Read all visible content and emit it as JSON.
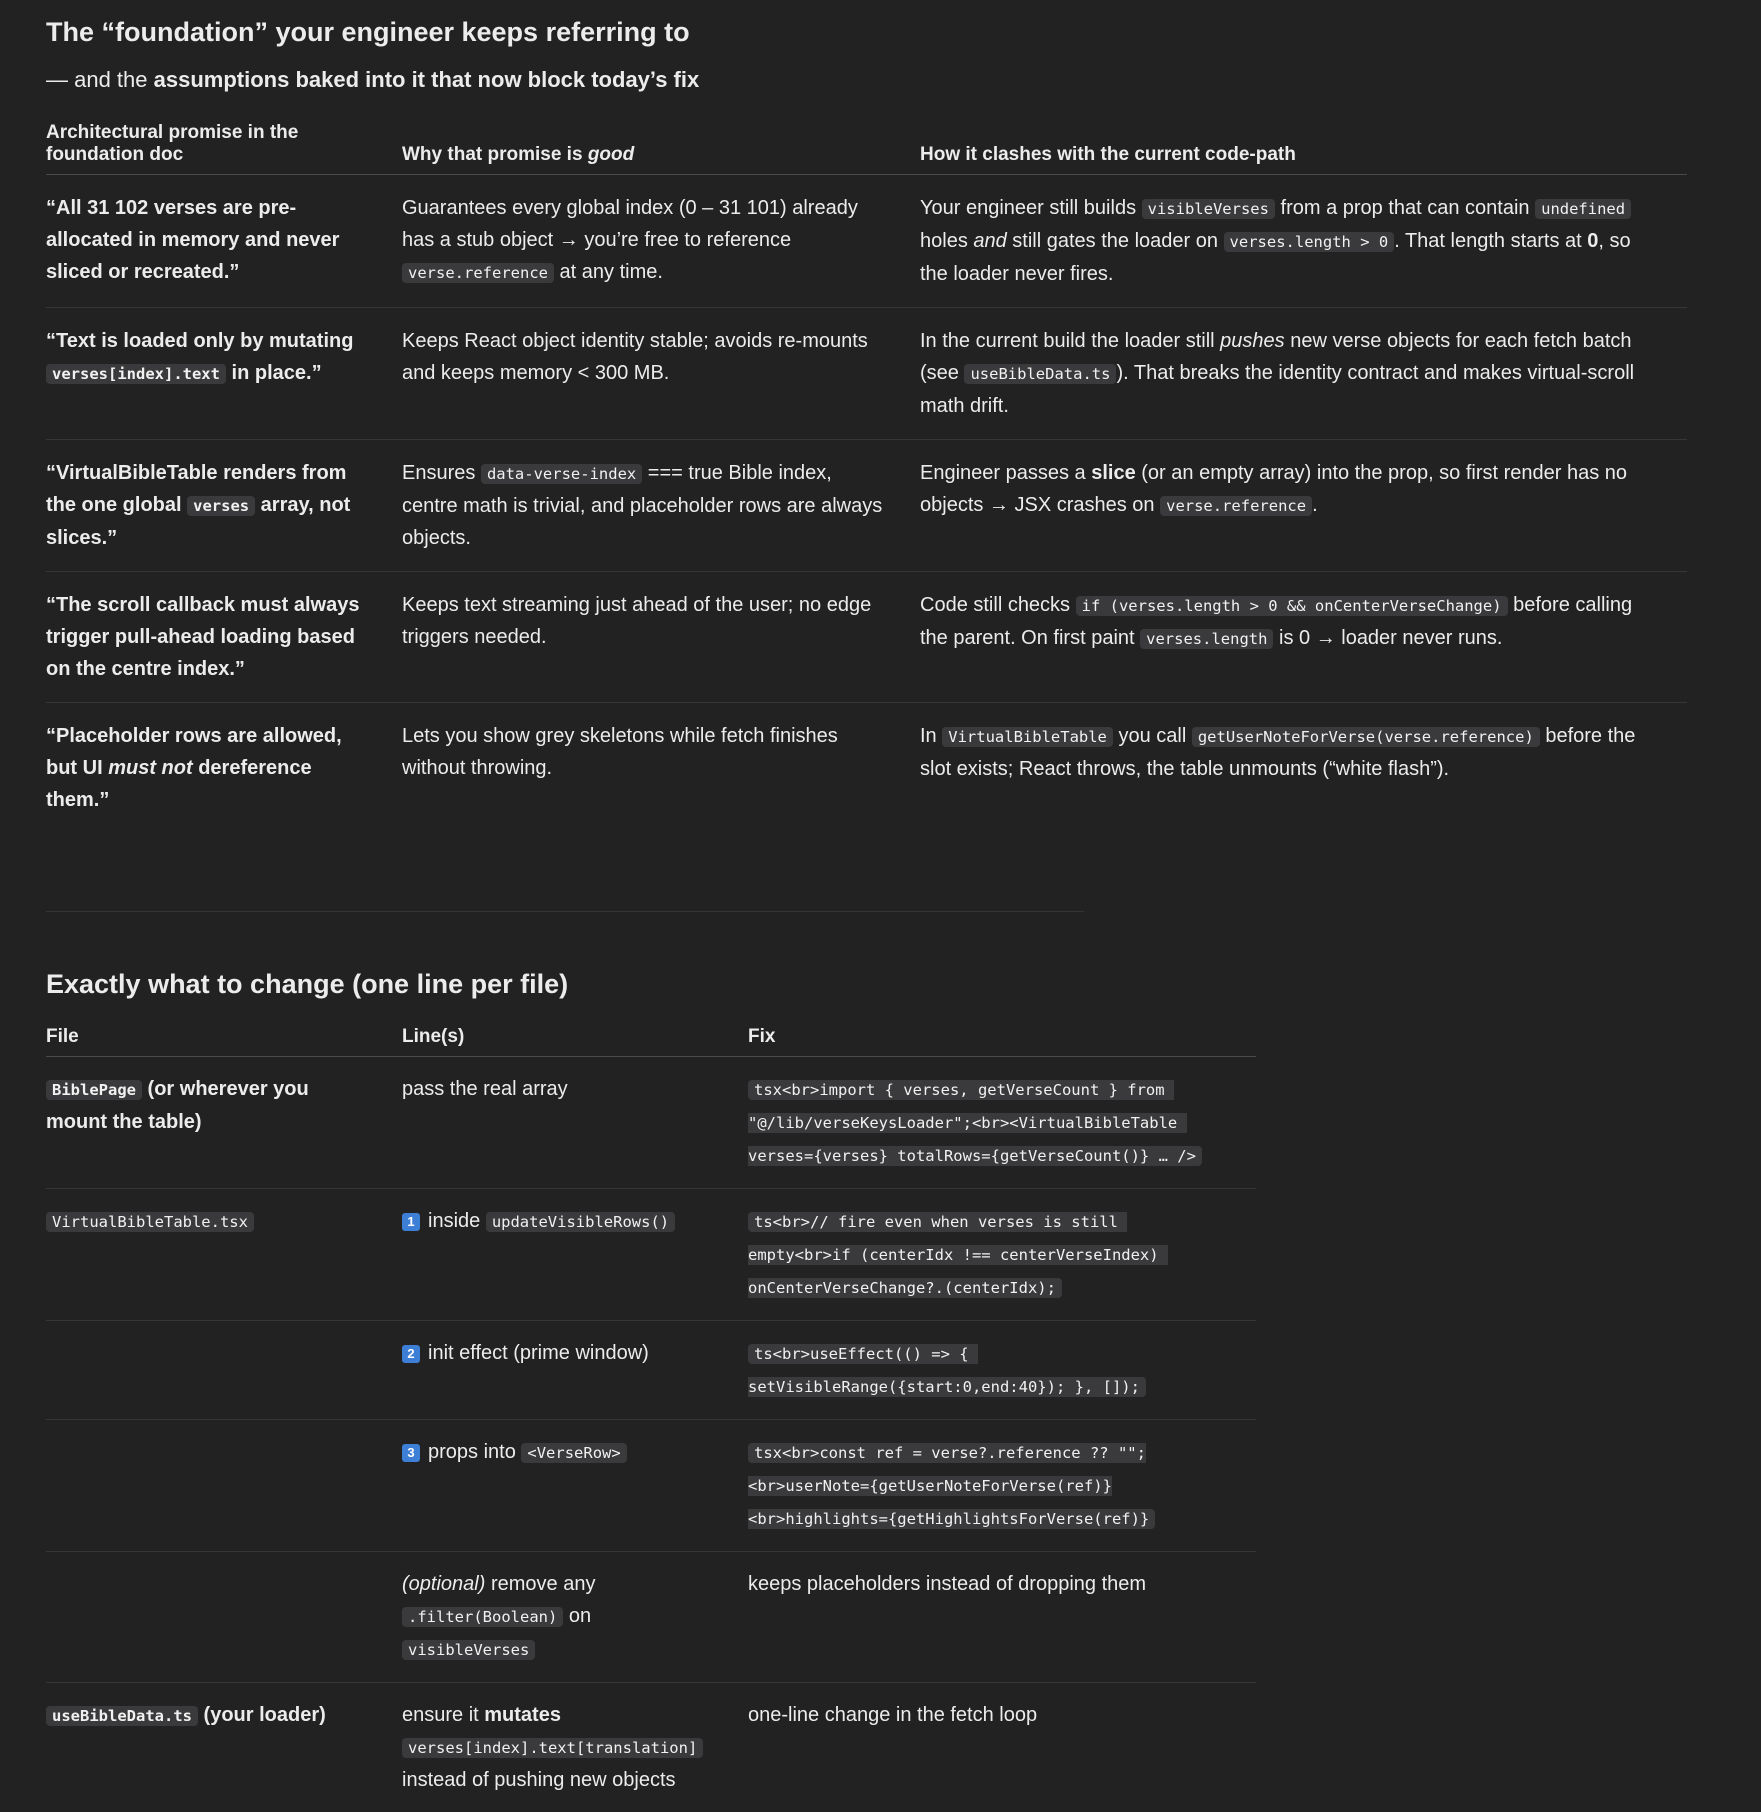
{
  "heading": "The “foundation” your engineer keeps referring to",
  "subtitle": {
    "prefix": "— and the ",
    "bold": "assumptions baked into it that now block today’s fix"
  },
  "promises_table": {
    "headers": {
      "col1": "Architectural promise in the foundation doc",
      "col2_prefix": "Why that promise is ",
      "col2_em": "good",
      "col3": "How it clashes with the current code-path"
    },
    "rows": [
      {
        "promise": "“All 31 102 verses are pre-allocated in memory and never sliced or recreated.”",
        "why": [
          "Guarantees every global index (0 – 31 101) already has a stub object → you’re free to reference ",
          "verse.reference",
          " at any time."
        ],
        "clash": [
          "Your engineer still builds ",
          "visibleVerses",
          " from a prop that can contain ",
          "undefined",
          " holes ",
          "and",
          " still gates the loader on ",
          "verses.length > 0",
          ". That length starts at ",
          "0",
          ", so the loader never fires."
        ]
      },
      {
        "promise": [
          "“Text is loaded only by mutating ",
          "verses[index].text",
          " in place.”"
        ],
        "why": "Keeps React object identity stable; avoids re-mounts and keeps memory < 300 MB.",
        "clash": [
          "In the current build the loader still ",
          "pushes",
          " new verse objects for each fetch batch (see ",
          "useBibleData.ts",
          "). That breaks the identity contract and makes virtual-scroll math drift."
        ]
      },
      {
        "promise": [
          "“VirtualBibleTable renders from the one global ",
          "verses",
          " array, not slices.”"
        ],
        "why": [
          "Ensures ",
          "data-verse-index",
          " === true Bible index, centre math is trivial, and placeholder rows are always objects."
        ],
        "clash": [
          "Engineer passes a ",
          "slice",
          " (or an empty array) into the prop, so first render has no objects → JSX crashes on ",
          "verse.reference",
          "."
        ]
      },
      {
        "promise": "“The scroll callback must always trigger pull-ahead loading based on the centre index.”",
        "why": "Keeps text streaming just ahead of the user; no edge triggers needed.",
        "clash": [
          "Code still checks ",
          "if (verses.length > 0 && onCenterVerseChange)",
          " before calling the parent. On first paint ",
          "verses.length",
          " is 0 → loader never runs."
        ]
      },
      {
        "promise": [
          "“Placeholder rows are allowed, but UI ",
          "must not",
          " dereference them.”"
        ],
        "why": "Lets you show grey skeletons while fetch finishes without throwing.",
        "clash": [
          "In ",
          "VirtualBibleTable",
          " you call ",
          "getUserNoteForVerse(verse.reference)",
          " before the slot exists; React throws, the table unmounts (“white flash”)."
        ]
      }
    ]
  },
  "section2_heading": "Exactly what to change (one line per file)",
  "changes_table": {
    "headers": {
      "file": "File",
      "lines": "Line(s)",
      "fix": "Fix"
    },
    "rows": [
      {
        "file_code": "BiblePage",
        "file_text": " (or wherever you mount the table)",
        "lines": "pass the real array",
        "fix": "tsx<br>import { verses, getVerseCount } from \"@/lib/verseKeysLoader\";<br><VirtualBibleTable verses={verses} totalRows={getVerseCount()} … />"
      },
      {
        "file_code": "VirtualBibleTable.tsx",
        "num": "1",
        "lines_prefix": "inside ",
        "lines_code": "updateVisibleRows()",
        "fix": "ts<br>// fire even when verses is still empty<br>if (centerIdx !== centerVerseIndex) onCenterVerseChange?.(centerIdx);"
      },
      {
        "num": "2",
        "lines": "init effect (prime window)",
        "fix": "ts<br>useEffect(() => { setVisibleRange({start:0,end:40}); }, []);"
      },
      {
        "num": "3",
        "lines_prefix": "props into ",
        "lines_code": "<VerseRow>",
        "fix": "tsx<br>const ref = verse?.reference ?? \"\";<br>userNote={getUserNoteForVerse(ref)}<br>highlights={getHighlightsForVerse(ref)}"
      },
      {
        "lines_em": "(optional)",
        "lines_mid": " remove any ",
        "lines_code1": ".filter(Boolean)",
        "lines_on": " on ",
        "lines_code2": "visibleVerses",
        "fix_text": "keeps placeholders instead of dropping them"
      },
      {
        "file_code": "useBibleData.ts",
        "file_text": " (your loader)",
        "lines_prefix": "ensure it ",
        "lines_bold": "mutates",
        "lines_code": "verses[index].text[translation]",
        "lines_suffix": " instead of pushing new objects",
        "fix_text": "one-line change in the fetch loop"
      }
    ]
  }
}
